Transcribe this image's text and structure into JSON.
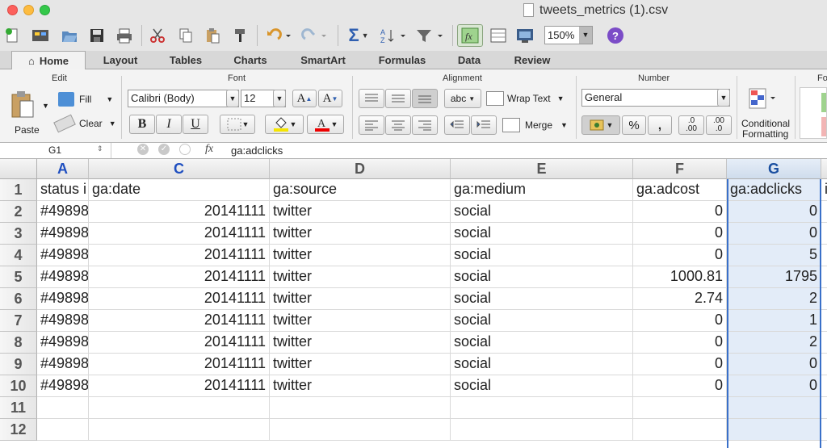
{
  "window": {
    "title": "tweets_metrics (1).csv"
  },
  "toolbar": {
    "zoom": "150%"
  },
  "tabs": [
    "Home",
    "Layout",
    "Tables",
    "Charts",
    "SmartArt",
    "Formulas",
    "Data",
    "Review"
  ],
  "ribbon": {
    "edit_label": "Edit",
    "fill_label": "Fill",
    "clear_label": "Clear",
    "paste_label": "Paste",
    "font_label": "Font",
    "font_name": "Calibri (Body)",
    "font_size": "12",
    "alignment_label": "Alignment",
    "abc_label": "abc",
    "wrap_text_label": "Wrap Text",
    "merge_label": "Merge",
    "number_label": "Number",
    "number_format": "General",
    "conditional_label_1": "Conditional",
    "conditional_label_2": "Formatting",
    "cut_label": "Fo"
  },
  "formula_bar": {
    "cell_ref": "G1",
    "value": "ga:adclicks"
  },
  "columns": [
    "A",
    "C",
    "D",
    "E",
    "F",
    "G"
  ],
  "rows": [
    {
      "num": "1",
      "cells": [
        "status i",
        "ga:date",
        "ga:source",
        "ga:medium",
        "ga:adcost",
        "ga:adclicks"
      ]
    },
    {
      "num": "2",
      "cells": [
        "#49898",
        "20141111",
        "twitter",
        "social",
        "0",
        "0"
      ]
    },
    {
      "num": "3",
      "cells": [
        "#49898",
        "20141111",
        "twitter",
        "social",
        "0",
        "0"
      ]
    },
    {
      "num": "4",
      "cells": [
        "#49898",
        "20141111",
        "twitter",
        "social",
        "0",
        "5"
      ]
    },
    {
      "num": "5",
      "cells": [
        "#49898",
        "20141111",
        "twitter",
        "social",
        "1000.81",
        "1795"
      ]
    },
    {
      "num": "6",
      "cells": [
        "#49898",
        "20141111",
        "twitter",
        "social",
        "2.74",
        "2"
      ]
    },
    {
      "num": "7",
      "cells": [
        "#49898",
        "20141111",
        "twitter",
        "social",
        "0",
        "1"
      ]
    },
    {
      "num": "8",
      "cells": [
        "#49898",
        "20141111",
        "twitter",
        "social",
        "0",
        "2"
      ]
    },
    {
      "num": "9",
      "cells": [
        "#49898",
        "20141111",
        "twitter",
        "social",
        "0",
        "0"
      ]
    },
    {
      "num": "10",
      "cells": [
        "#49898",
        "20141111",
        "twitter",
        "social",
        "0",
        "0"
      ]
    },
    {
      "num": "11",
      "cells": [
        "",
        "",
        "",
        "",
        "",
        ""
      ]
    },
    {
      "num": "12",
      "cells": [
        "",
        "",
        "",
        "",
        "",
        ""
      ]
    }
  ],
  "next_col_hint": "i"
}
